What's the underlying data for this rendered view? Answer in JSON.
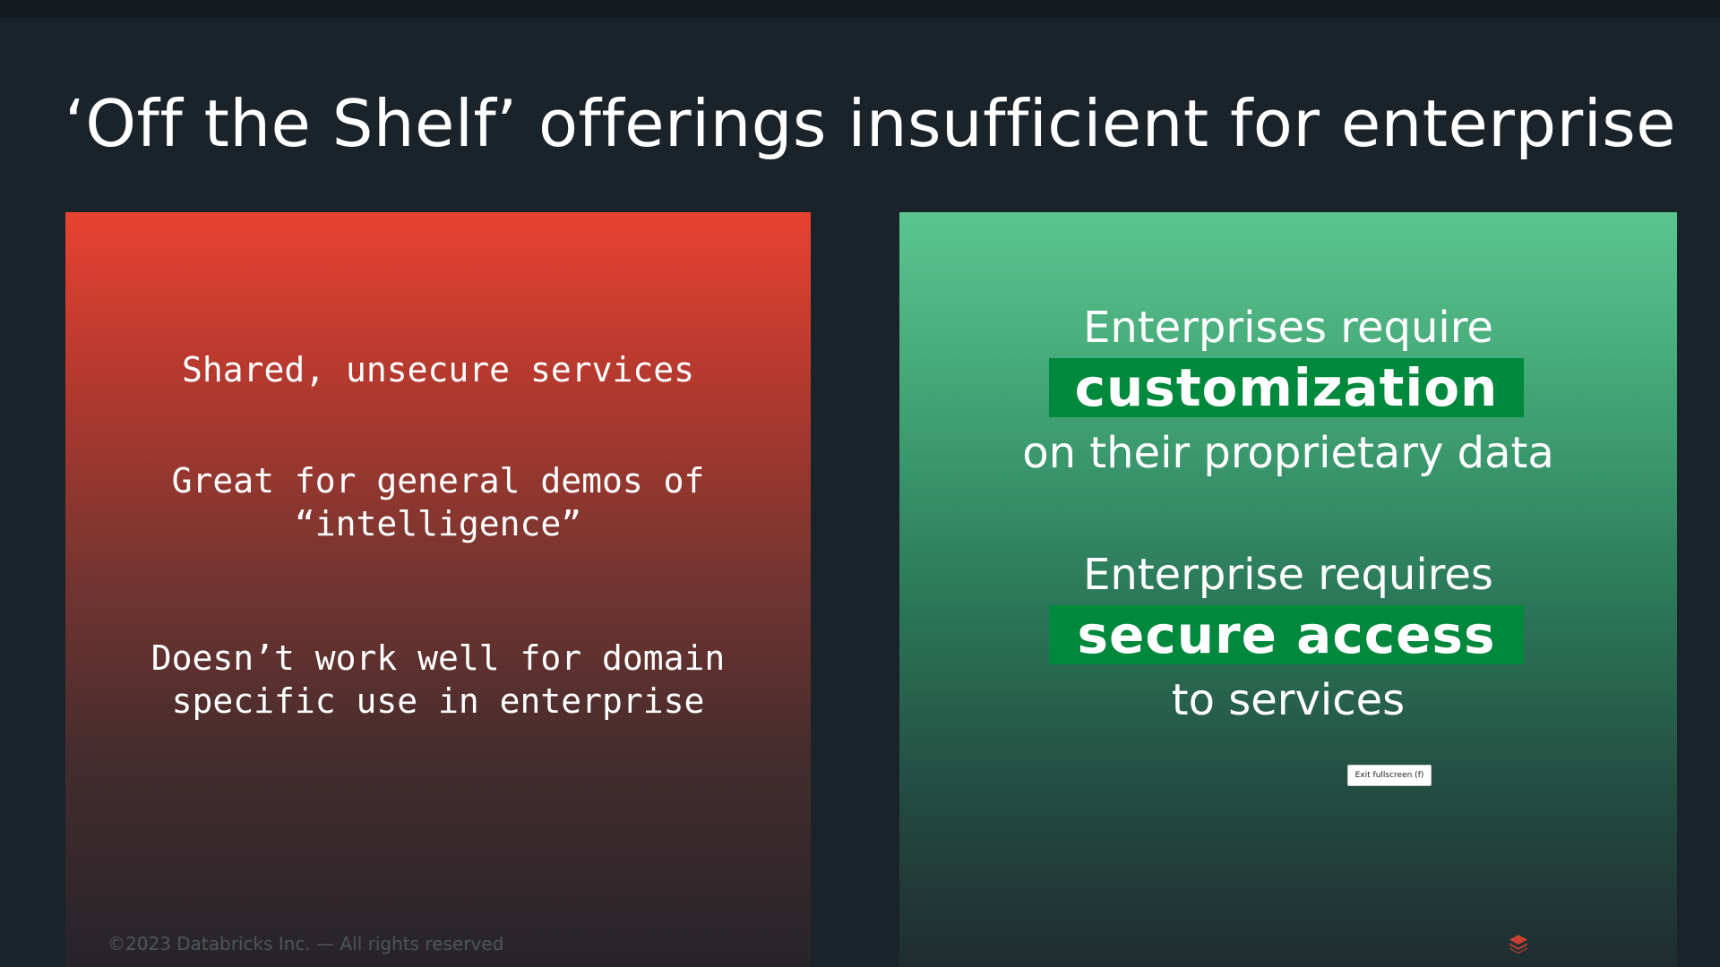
{
  "slide": {
    "title": "‘Off the Shelf’ offerings insufficient for enterprise",
    "left_panel": {
      "points": [
        "Shared, unsecure services",
        "Great for general demos of “intelligence”",
        "Doesn’t work well for domain specific use in enterprise"
      ]
    },
    "right_panel": {
      "groups": [
        {
          "before": "Enterprises require",
          "highlight": "customization",
          "after": "on their proprietary data"
        },
        {
          "before": "Enterprise requires",
          "highlight": "secure access",
          "after": "to services"
        }
      ],
      "highlight_color": "#00883c"
    },
    "footer": "©2023 Databricks Inc. — All rights reserved",
    "logo_icon": "databricks-logo-icon",
    "accent_red": "#e84232",
    "accent_green": "#5cc58f"
  },
  "overlay": {
    "exit_fullscreen_label": "Exit fullscreen (f)"
  }
}
